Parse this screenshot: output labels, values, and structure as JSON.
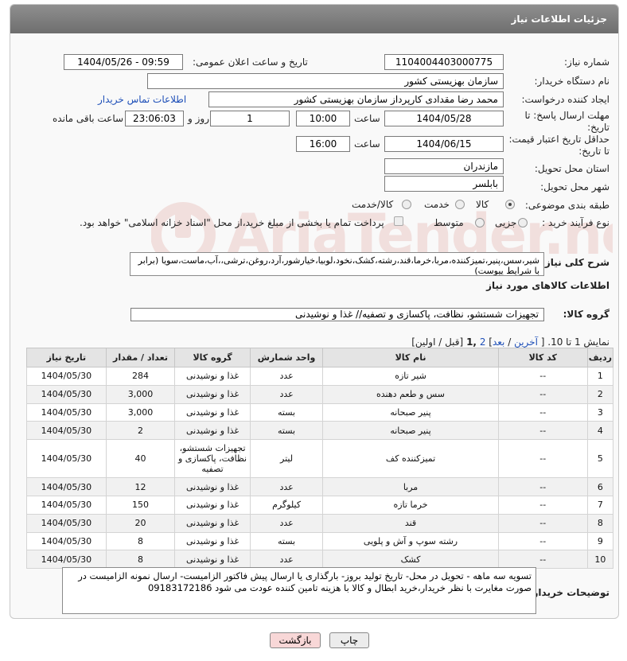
{
  "header": {
    "title": "جزئیات اطلاعات نیاز"
  },
  "need_number": {
    "label": "شماره نیاز:",
    "value": "1104004403000775"
  },
  "announce": {
    "label": "تاریخ و ساعت اعلان عمومی:",
    "value": "1404/05/26 - 09:59"
  },
  "buyer_org": {
    "label": "نام دستگاه خریدار:",
    "value": "سازمان بهزیستی کشور"
  },
  "requester": {
    "label": "ایجاد کننده درخواست:",
    "value": "محمد رضا  مقدادی کارپرداز سازمان بهزیستی کشور",
    "contact_link": "اطلاعات تماس خریدار"
  },
  "reply_deadline": {
    "label_line1": "مهلت ارسال پاسخ: تا",
    "label_line2": "تاریخ:",
    "date": "1404/05/28",
    "time_label": "ساعت",
    "time": "10:00",
    "days": "1",
    "days_label": "روز و",
    "remaining": "23:06:03",
    "remaining_label": "ساعت باقی مانده"
  },
  "price_validity": {
    "label_line1": "حداقل تاریخ اعتبار قیمت:",
    "label_line2": "تا تاریخ:",
    "date": "1404/06/15",
    "time_label": "ساعت",
    "time": "16:00"
  },
  "delivery_province": {
    "label": "استان محل تحویل:",
    "value": "مازندران"
  },
  "delivery_city": {
    "label": "شهر محل تحویل:",
    "value": "بابلسر"
  },
  "category": {
    "label": "طبقه بندی موضوعی:",
    "options": [
      "کالا",
      "خدمت",
      "کالا/خدمت"
    ],
    "selected": "کالا"
  },
  "process": {
    "label": "نوع فرآیند خرید :",
    "options": [
      "جزیی",
      "متوسط"
    ],
    "payment_note": "پرداخت تمام یا بخشی از مبلغ خرید،از محل \"اسناد خزانه اسلامی\" خواهد بود."
  },
  "description": {
    "label": "شرح کلی نیاز:",
    "value": "شیر،سس،پنیر،تمیزکننده،مربا،خرما،قند،رشته،کشک،نخود،لوبیا،خیارشور،آرد،روغن،ترشی،،آب،ماست،سویا (برابر با شرایط پیوست)"
  },
  "goods_section_title": "اطلاعات کالاهای مورد نیاز",
  "goods_group": {
    "label": "گروه کالا:",
    "value": "تجهیزات شستشو، نظافت، پاکسازی و تصفیه// غذا و نوشیدنی"
  },
  "pagination": {
    "text": "نمایش 1 تا 10. [",
    "last": "آخرین",
    "next": "بعد",
    "page2": "2",
    "current": "1",
    "tail": "[قبل / اولین]"
  },
  "table": {
    "headers": [
      "ردیف",
      "کد کالا",
      "نام کالا",
      "واحد شمارش",
      "گروه کالا",
      "تعداد / مقدار",
      "تاریخ نیاز"
    ],
    "rows": [
      [
        "1",
        "--",
        "شیر تازه",
        "عدد",
        "غذا و نوشیدنی",
        "284",
        "1404/05/30"
      ],
      [
        "2",
        "--",
        "سس و طعم دهنده",
        "عدد",
        "غذا و نوشیدنی",
        "3,000",
        "1404/05/30"
      ],
      [
        "3",
        "--",
        "پنیر صبحانه",
        "بسته",
        "غذا و نوشیدنی",
        "3,000",
        "1404/05/30"
      ],
      [
        "4",
        "--",
        "پنیر صبحانه",
        "بسته",
        "غذا و نوشیدنی",
        "2",
        "1404/05/30"
      ],
      [
        "5",
        "--",
        "تمیزکننده کف",
        "لیتر",
        "تجهیزات شستشو، نظافت، پاکسازی و تصفیه",
        "40",
        "1404/05/30"
      ],
      [
        "6",
        "--",
        "مربا",
        "عدد",
        "غذا و نوشیدنی",
        "12",
        "1404/05/30"
      ],
      [
        "7",
        "--",
        "خرما تازه",
        "کیلوگرم",
        "غذا و نوشیدنی",
        "150",
        "1404/05/30"
      ],
      [
        "8",
        "--",
        "قند",
        "عدد",
        "غذا و نوشیدنی",
        "20",
        "1404/05/30"
      ],
      [
        "9",
        "--",
        "رشته سوپ و آش و پلویی",
        "بسته",
        "غذا و نوشیدنی",
        "8",
        "1404/05/30"
      ],
      [
        "10",
        "--",
        "کشک",
        "عدد",
        "غذا و نوشیدنی",
        "8",
        "1404/05/30"
      ]
    ]
  },
  "buyer_notes": {
    "label": "توضیحات خریدار:",
    "value": "تسویه سه ماهه - تحویل در محل- تاریخ تولید بروز- بارگذاری یا ارسال پیش فاکتور الزامیست- ارسال نمونه الزامیست در صورت مغایرت با نظر خریدار،خرید ابطال و کالا با هزینه تامین کننده عودت می شود 09183172186"
  },
  "buttons": {
    "print": "چاپ",
    "back": "بازگشت"
  },
  "watermark": {
    "text": "AriaTender.neT"
  },
  "colors": {
    "header": "#7a7a7a",
    "link": "#1e4fb8",
    "back_button": "#f8d7d7",
    "print_button": "#e8e8e8"
  }
}
